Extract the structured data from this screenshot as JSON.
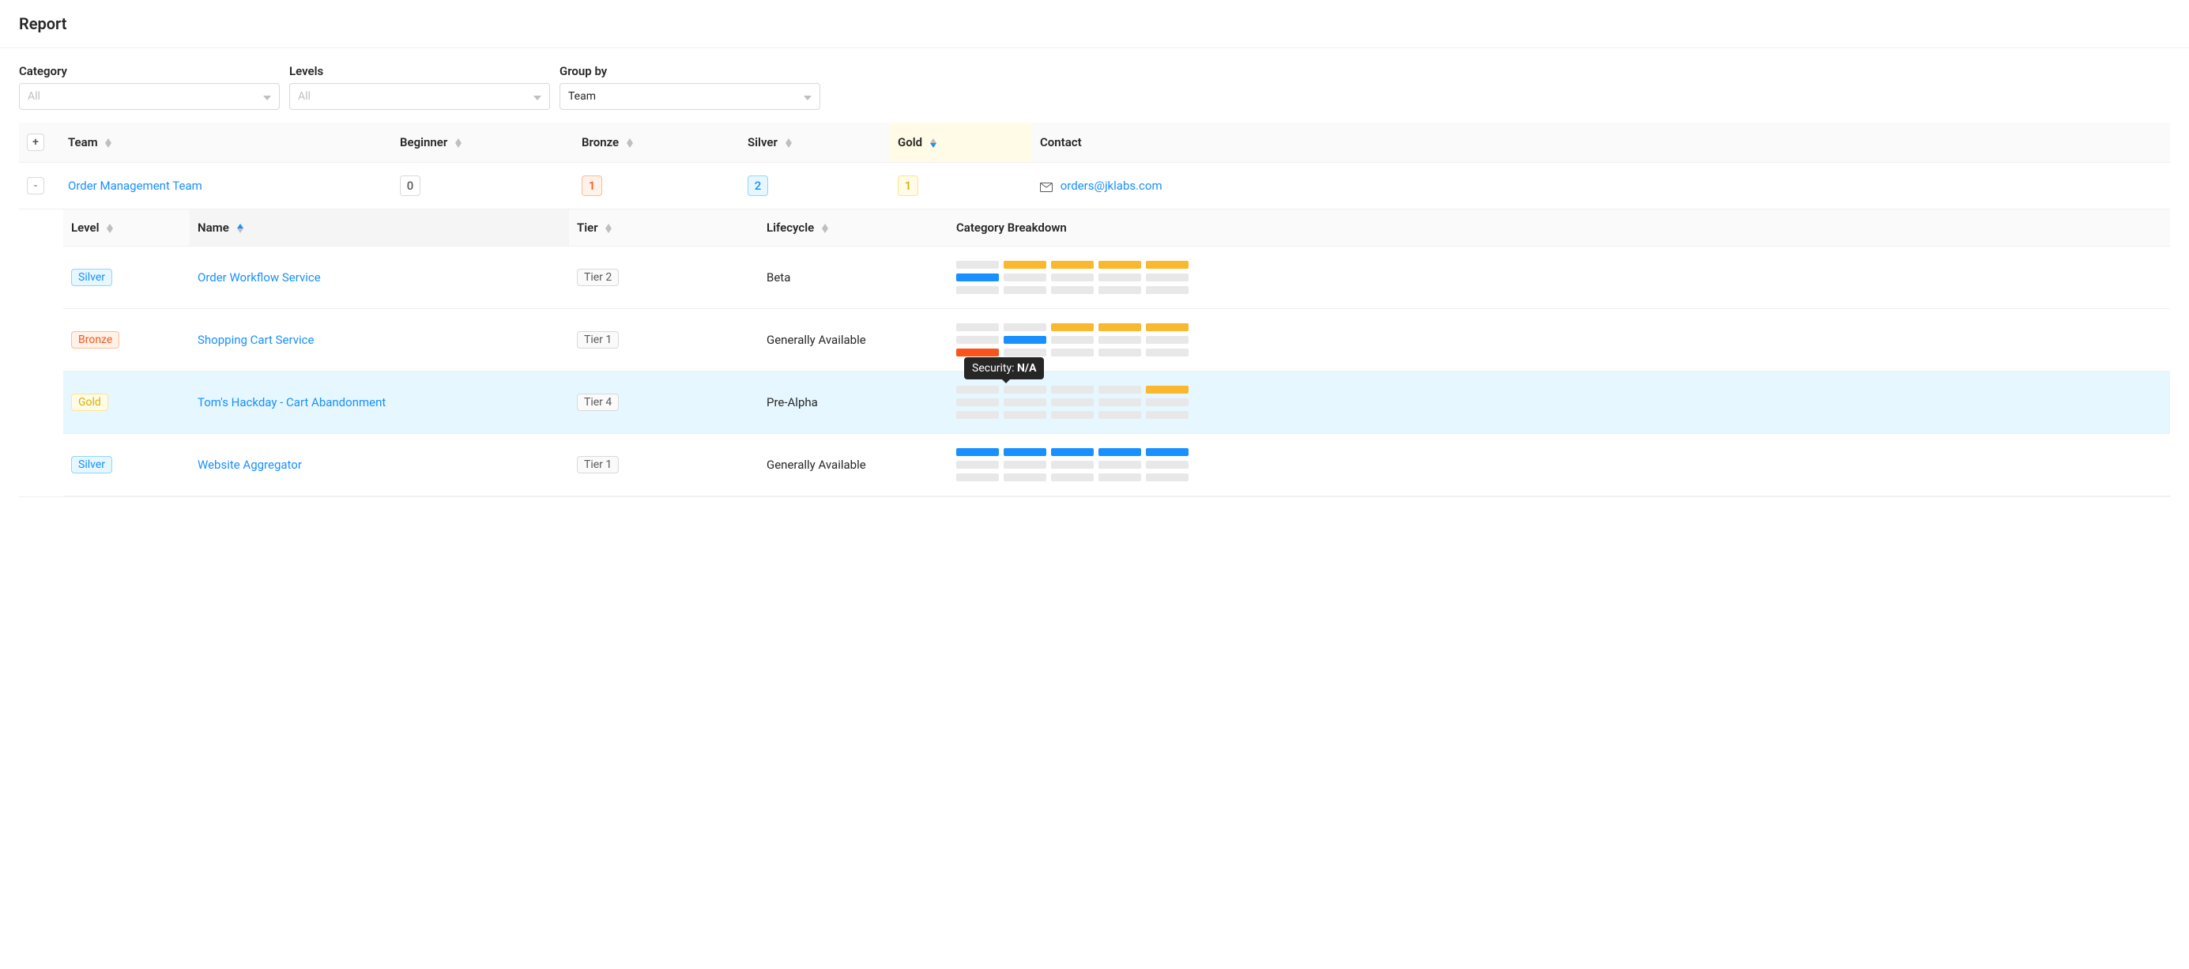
{
  "page": {
    "title": "Report"
  },
  "filters": {
    "category": {
      "label": "Category",
      "placeholder": "All",
      "value": ""
    },
    "levels": {
      "label": "Levels",
      "placeholder": "All",
      "value": ""
    },
    "groupby": {
      "label": "Group by",
      "value": "Team"
    }
  },
  "table": {
    "columns": {
      "team": "Team",
      "beginner": "Beginner",
      "bronze": "Bronze",
      "silver": "Silver",
      "gold": "Gold",
      "contact": "Contact"
    },
    "rows": [
      {
        "team": "Order Management Team",
        "beginner": 0,
        "bronze": 1,
        "silver": 2,
        "gold": 1,
        "contact": "orders@jklabs.com"
      }
    ]
  },
  "detail": {
    "columns": {
      "level": "Level",
      "name": "Name",
      "tier": "Tier",
      "lifecycle": "Lifecycle",
      "breakdown": "Category Breakdown"
    },
    "rows": [
      {
        "level": "Silver",
        "level_style": "silver",
        "name": "Order Workflow Service",
        "tier": "Tier 2",
        "lifecycle": "Beta",
        "highlight": false,
        "breakdown": [
          "grey",
          "yellow",
          "yellow",
          "yellow",
          "yellow",
          "blue",
          "grey",
          "grey",
          "grey",
          "grey",
          "grey",
          "grey",
          "grey",
          "grey",
          "grey"
        ]
      },
      {
        "level": "Bronze",
        "level_style": "bronze",
        "name": "Shopping Cart Service",
        "tier": "Tier 1",
        "lifecycle": "Generally Available",
        "highlight": false,
        "breakdown": [
          "grey",
          "grey",
          "yellow",
          "yellow",
          "yellow",
          "grey",
          "blue",
          "grey",
          "grey",
          "grey",
          "orange",
          "grey",
          "grey",
          "grey",
          "grey"
        ]
      },
      {
        "level": "Gold",
        "level_style": "gold",
        "name": "Tom's Hackday - Cart Abandonment",
        "tier": "Tier 4",
        "lifecycle": "Pre-Alpha",
        "highlight": true,
        "tooltip": {
          "label": "Security:",
          "value": "N/A"
        },
        "breakdown": [
          "grey",
          "grey",
          "grey",
          "grey",
          "yellow",
          "grey",
          "grey",
          "grey",
          "grey",
          "grey",
          "grey",
          "grey",
          "grey",
          "grey",
          "grey"
        ]
      },
      {
        "level": "Silver",
        "level_style": "silver",
        "name": "Website Aggregator",
        "tier": "Tier 1",
        "lifecycle": "Generally Available",
        "highlight": false,
        "breakdown": [
          "blue",
          "blue",
          "blue",
          "blue",
          "blue",
          "grey",
          "grey",
          "grey",
          "grey",
          "grey",
          "grey",
          "grey",
          "grey",
          "grey",
          "grey"
        ]
      }
    ]
  },
  "colors": {
    "bd": {
      "grey": "#e8e8e8",
      "blue": "#1890ff",
      "yellow": "#fab82e",
      "orange": "#fa541c"
    }
  }
}
